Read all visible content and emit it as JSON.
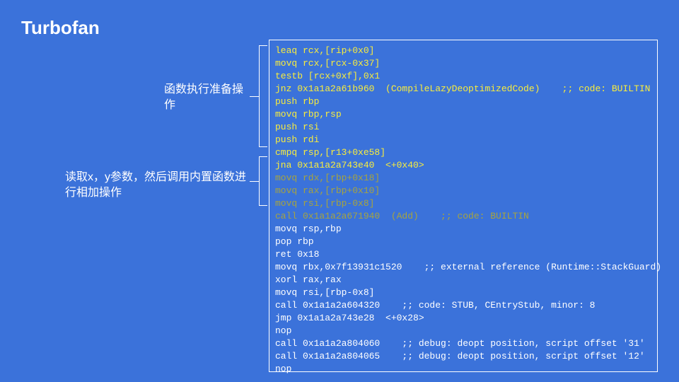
{
  "title": "Turbofan",
  "annotation1": "函数执行准备操作",
  "annotation2": "读取x，y参数，然后调用内置函数进行相加操作",
  "code": {
    "block1": [
      "leaq rcx,[rip+0x0]",
      "movq rcx,[rcx-0x37]",
      "testb [rcx+0xf],0x1",
      "jnz 0x1a1a2a61b960  (CompileLazyDeoptimizedCode)    ;; code: BUILTIN",
      "push rbp",
      "movq rbp,rsp",
      "push rsi",
      "push rdi",
      "cmpq rsp,[r13+0xe58]",
      "jna 0x1a1a2a743e40  <+0x40>"
    ],
    "block2": [
      "movq rdx,[rbp+0x18]",
      "movq rax,[rbp+0x10]",
      "movq rsi,[rbp-0x8]",
      "call 0x1a1a2a671940  (Add)    ;; code: BUILTIN"
    ],
    "block3": [
      "movq rsp,rbp",
      "pop rbp",
      "ret 0x18",
      "movq rbx,0x7f13931c1520    ;; external reference (Runtime::StackGuard)",
      "xorl rax,rax",
      "movq rsi,[rbp-0x8]",
      "call 0x1a1a2a604320    ;; code: STUB, CEntryStub, minor: 8",
      "jmp 0x1a1a2a743e28  <+0x28>",
      "nop",
      "call 0x1a1a2a804060    ;; debug: deopt position, script offset '31'",
      "call 0x1a1a2a804065    ;; debug: deopt position, script offset '12'",
      "nop"
    ]
  }
}
